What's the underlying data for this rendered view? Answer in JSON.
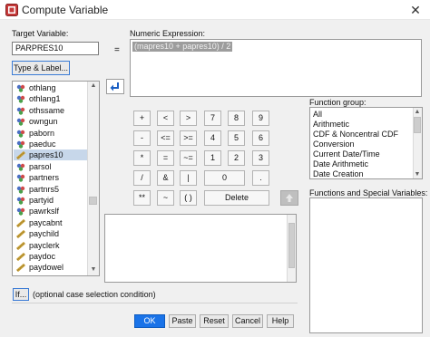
{
  "window": {
    "title": "Compute Variable",
    "close_glyph": "✕"
  },
  "target": {
    "label": "Target Variable:",
    "value": "PARPRES10",
    "type_label_button": "Type & Label..."
  },
  "equals_sign": "=",
  "expression": {
    "label": "Numeric Expression:",
    "value": "(mapres10 + papres10) / 2"
  },
  "variables": [
    {
      "name": "othlang",
      "icon": "nominal-icon"
    },
    {
      "name": "othlang1",
      "icon": "nominal-icon"
    },
    {
      "name": "othssame",
      "icon": "nominal-icon"
    },
    {
      "name": "owngun",
      "icon": "nominal-icon"
    },
    {
      "name": "paborn",
      "icon": "nominal-icon"
    },
    {
      "name": "paeduc",
      "icon": "nominal-icon"
    },
    {
      "name": "papres10",
      "icon": "scale-icon",
      "selected": true
    },
    {
      "name": "parsol",
      "icon": "nominal-icon"
    },
    {
      "name": "partners",
      "icon": "nominal-icon"
    },
    {
      "name": "partnrs5",
      "icon": "nominal-icon"
    },
    {
      "name": "partyid",
      "icon": "nominal-icon"
    },
    {
      "name": "pawrkslf",
      "icon": "nominal-icon"
    },
    {
      "name": "paycabnt",
      "icon": "scale-icon"
    },
    {
      "name": "paychild",
      "icon": "scale-icon"
    },
    {
      "name": "payclerk",
      "icon": "scale-icon"
    },
    {
      "name": "paydoc",
      "icon": "scale-icon"
    },
    {
      "name": "paydowel",
      "icon": "scale-icon"
    }
  ],
  "keypad": {
    "row1": [
      "+",
      "<",
      ">",
      "7",
      "8",
      "9"
    ],
    "row2": [
      "-",
      "<=",
      ">=",
      "4",
      "5",
      "6"
    ],
    "row3": [
      "*",
      "=",
      "~=",
      "1",
      "2",
      "3"
    ],
    "row4": [
      "/",
      "&",
      "|",
      "0",
      "."
    ],
    "row5": [
      "**",
      "~",
      "( )",
      "Delete"
    ]
  },
  "function_group": {
    "label": "Function group:",
    "items": [
      "All",
      "Arithmetic",
      "CDF & Noncentral CDF",
      "Conversion",
      "Current Date/Time",
      "Date Arithmetic",
      "Date Creation"
    ]
  },
  "functions": {
    "label": "Functions and Special Variables:"
  },
  "if_button": "If...",
  "if_condition": "(optional case selection condition)",
  "buttons": {
    "ok": "OK",
    "paste": "Paste",
    "reset": "Reset",
    "cancel": "Cancel",
    "help": "Help"
  }
}
